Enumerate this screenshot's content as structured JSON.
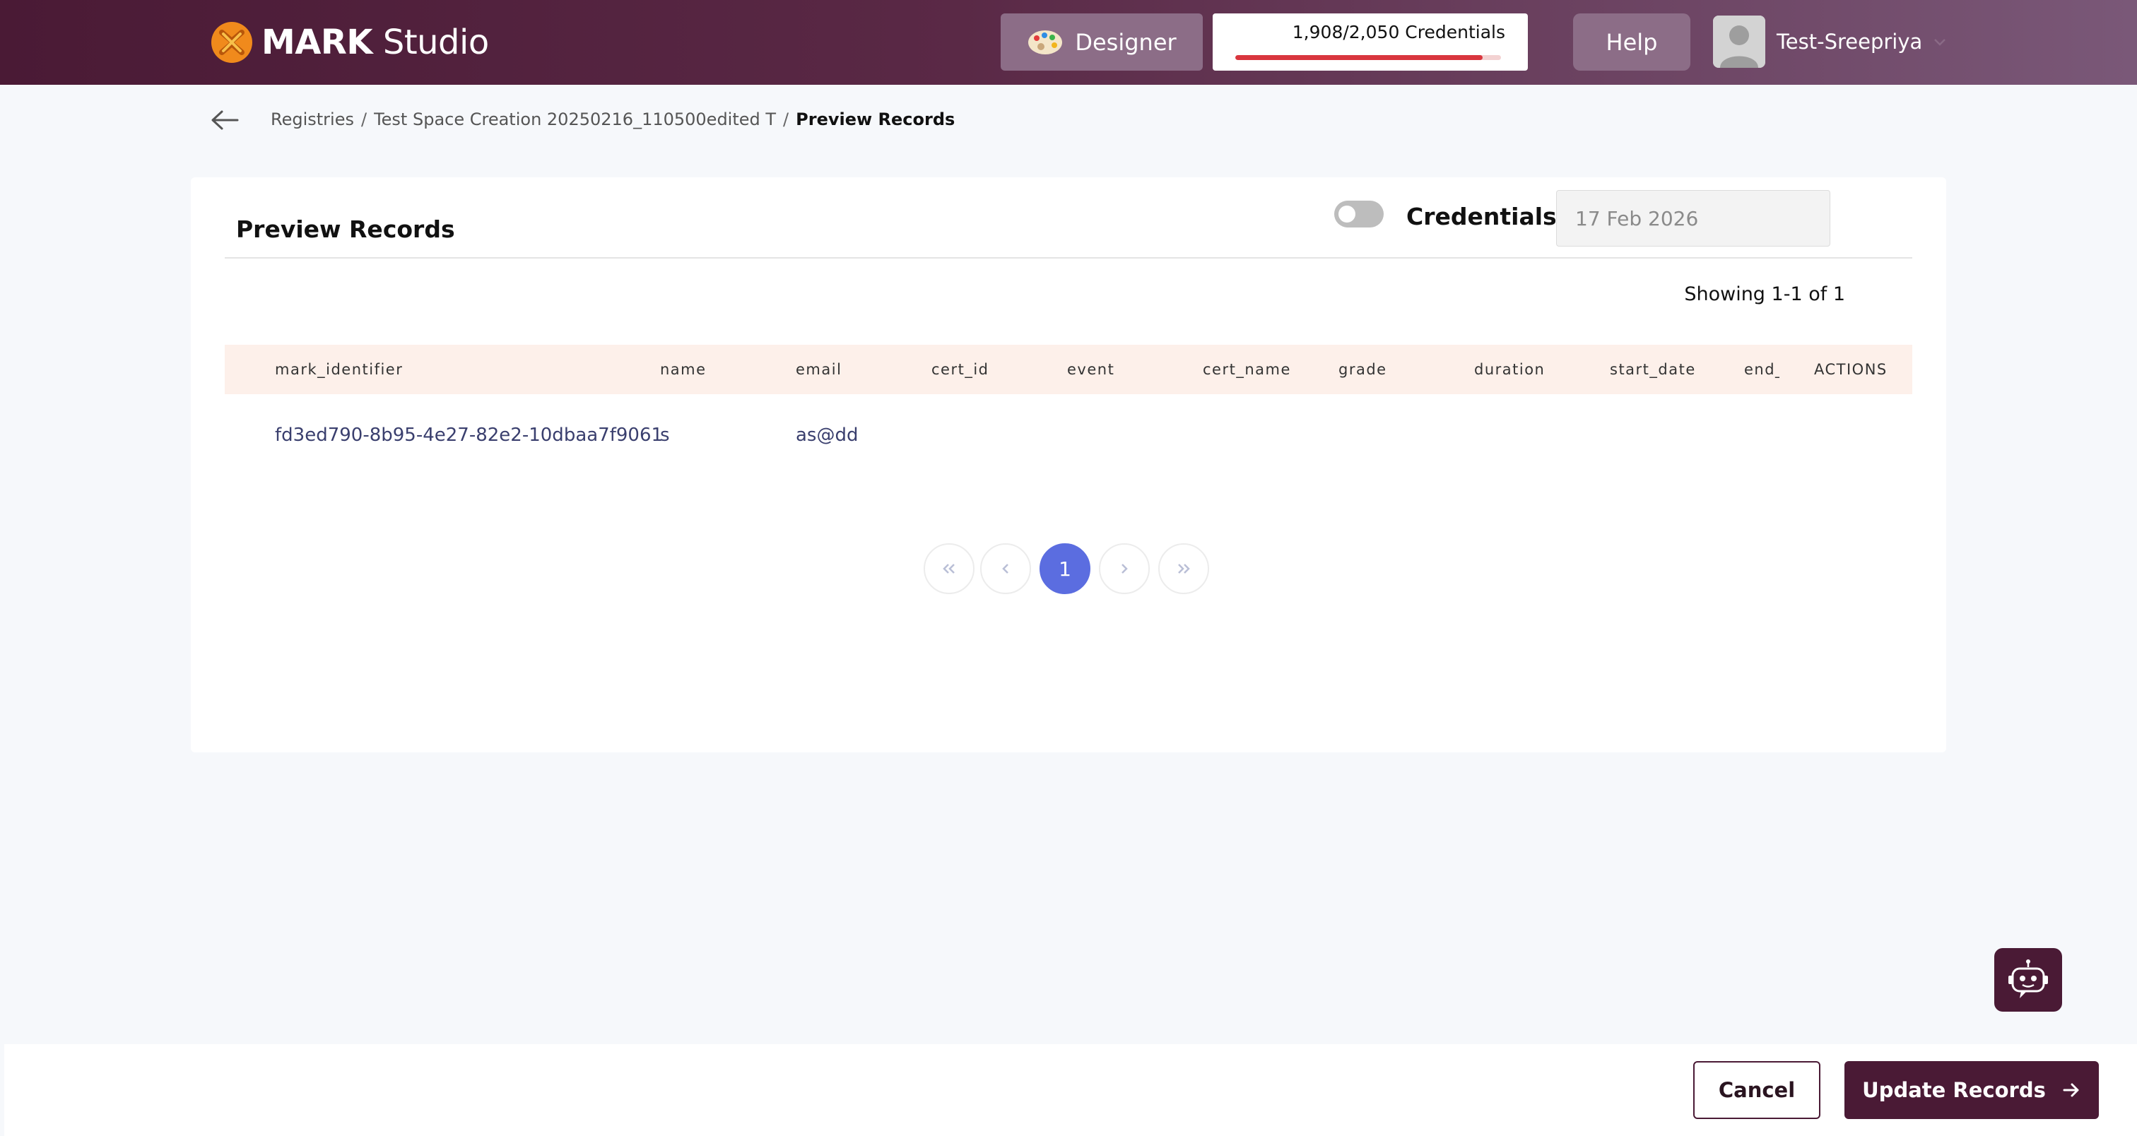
{
  "header": {
    "brand_bold": "MARK",
    "brand_light": "Studio",
    "designer_label": "Designer",
    "credits_text": "1,908/2,050 Credentials",
    "credits_used_fraction": 0.93,
    "help_label": "Help",
    "username": "Test-Sreepriya"
  },
  "breadcrumb": {
    "items": [
      "Registries",
      "Test Space Creation 20250216_110500edited T",
      "Preview Records"
    ],
    "separator": "/"
  },
  "card": {
    "title": "Preview Records",
    "validity_label": "Credentials Validity",
    "validity_toggle_on": false,
    "validity_date": "17 Feb 2026",
    "showing": "Showing 1-1 of 1"
  },
  "table": {
    "columns": [
      "mark_identifier",
      "name",
      "email",
      "cert_id",
      "event",
      "cert_name",
      "grade",
      "duration",
      "start_date",
      "end_date",
      "ACTIONS"
    ],
    "rows": [
      [
        "fd3ed790-8b95-4e27-82e2-10dbaa7f9061",
        "s",
        "as@dd",
        "",
        "",
        "",
        "",
        "",
        "",
        "",
        ""
      ]
    ]
  },
  "pagination": {
    "current_page": "1"
  },
  "footer": {
    "cancel_label": "Cancel",
    "update_label": "Update Records"
  },
  "colors": {
    "brand_dark": "#4a1a35",
    "accent_blue": "#5b6de0",
    "credit_bar": "#d9363e",
    "table_header_bg": "#fdf0ea"
  }
}
